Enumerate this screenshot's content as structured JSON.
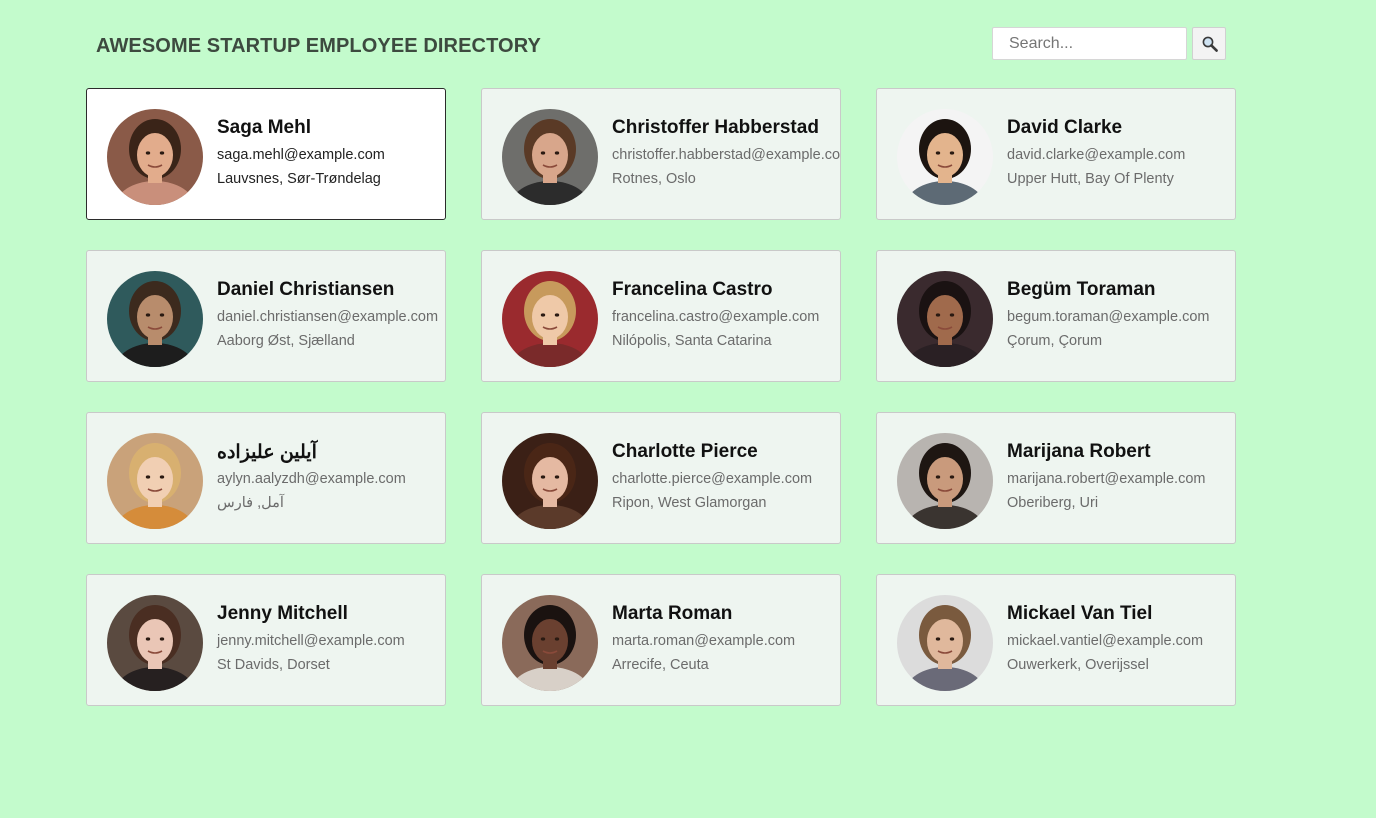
{
  "header": {
    "title": "AWESOME STARTUP EMPLOYEE DIRECTORY",
    "search_placeholder": "Search...",
    "search_value": "",
    "search_button_icon": "search-icon"
  },
  "employees": [
    {
      "name": "Saga Mehl",
      "email": "saga.mehl@example.com",
      "location": "Lauvsnes, Sør-Trøndelag",
      "selected": true,
      "bg": "#8a5a48",
      "skin": "#e2ac8c",
      "hair": "#3a2418",
      "shirt": "#c98f7b"
    },
    {
      "name": "Christoffer Habberstad",
      "email": "christoffer.habberstad@example.com",
      "location": "Rotnes, Oslo",
      "selected": false,
      "bg": "#6e6e6b",
      "skin": "#d8a68b",
      "hair": "#5a3a26",
      "shirt": "#2c2c2c"
    },
    {
      "name": "David Clarke",
      "email": "david.clarke@example.com",
      "location": "Upper Hutt, Bay Of Plenty",
      "selected": false,
      "bg": "#f4f4f4",
      "skin": "#e3b48d",
      "hair": "#1c1410",
      "shirt": "#5d6a75"
    },
    {
      "name": "Daniel Christiansen",
      "email": "daniel.christiansen@example.com",
      "location": "Aaborg Øst, Sjælland",
      "selected": false,
      "bg": "#2f5a5c",
      "skin": "#b88c6c",
      "hair": "#3c2a1e",
      "shirt": "#1d1d1d"
    },
    {
      "name": "Francelina Castro",
      "email": "francelina.castro@example.com",
      "location": "Nilópolis, Santa Catarina",
      "selected": false,
      "bg": "#9a2a2e",
      "skin": "#efc9a8",
      "hair": "#c79a5c",
      "shirt": "#7a2a2a"
    },
    {
      "name": "Begüm Toraman",
      "email": "begum.toraman@example.com",
      "location": "Çorum, Çorum",
      "selected": false,
      "bg": "#3a2a2e",
      "skin": "#a06a4c",
      "hair": "#1a1212",
      "shirt": "#2a2024"
    },
    {
      "name": "آیلین علیزاده",
      "email": "aylyn.aalyzdh@example.com",
      "location": "آمل, فارس",
      "selected": false,
      "bg": "#c9a27a",
      "skin": "#f1cfb3",
      "hair": "#d8b070",
      "shirt": "#d58c3a"
    },
    {
      "name": "Charlotte Pierce",
      "email": "charlotte.pierce@example.com",
      "location": "Ripon, West Glamorgan",
      "selected": false,
      "bg": "#3b2016",
      "skin": "#e5b9a2",
      "hair": "#4a2616",
      "shirt": "#5b3a2a"
    },
    {
      "name": "Marijana Robert",
      "email": "marijana.robert@example.com",
      "location": "Oberiberg, Uri",
      "selected": false,
      "bg": "#b8b4b0",
      "skin": "#c99a7c",
      "hair": "#1e1612",
      "shirt": "#3a3430"
    },
    {
      "name": "Jenny Mitchell",
      "email": "jenny.mitchell@example.com",
      "location": "St Davids, Dorset",
      "selected": false,
      "bg": "#5a4a40",
      "skin": "#eac6b6",
      "hair": "#4a2e22",
      "shirt": "#262020"
    },
    {
      "name": "Marta Roman",
      "email": "marta.roman@example.com",
      "location": "Arrecife, Ceuta",
      "selected": false,
      "bg": "#8a6a5a",
      "skin": "#6a4030",
      "hair": "#1a1210",
      "shirt": "#d8d0c8"
    },
    {
      "name": "Mickael Van Tiel",
      "email": "mickael.vantiel@example.com",
      "location": "Ouwerkerk, Overijssel",
      "selected": false,
      "bg": "#dcdcdc",
      "skin": "#e0b89c",
      "hair": "#7a5a3e",
      "shirt": "#6a6a78"
    }
  ]
}
